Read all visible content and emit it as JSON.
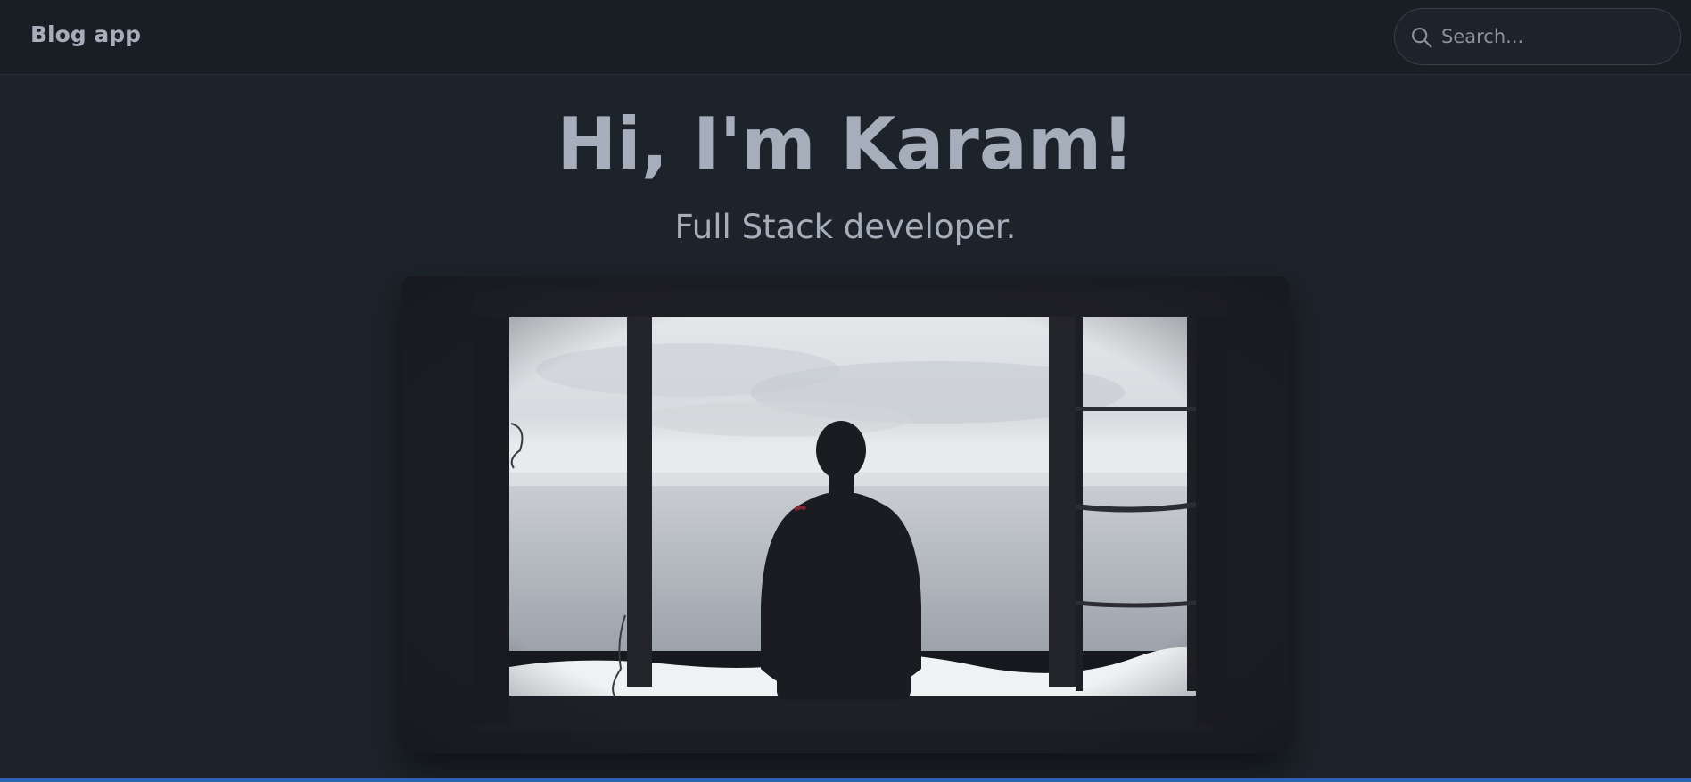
{
  "navbar": {
    "brand": "Blog app",
    "search_placeholder": "Search...",
    "search_value": "",
    "search_icon": "search-icon"
  },
  "hero": {
    "title": "Hi, I'm Karam!",
    "subtitle": "Full Stack developer.",
    "image_alt": "Silhouette of a person sitting in a window frame looking at the sea"
  },
  "colors": {
    "background": "#1d232a",
    "navbar": "#191e24",
    "text": "#a6adbb",
    "accent_strip": "#2a64b8"
  }
}
